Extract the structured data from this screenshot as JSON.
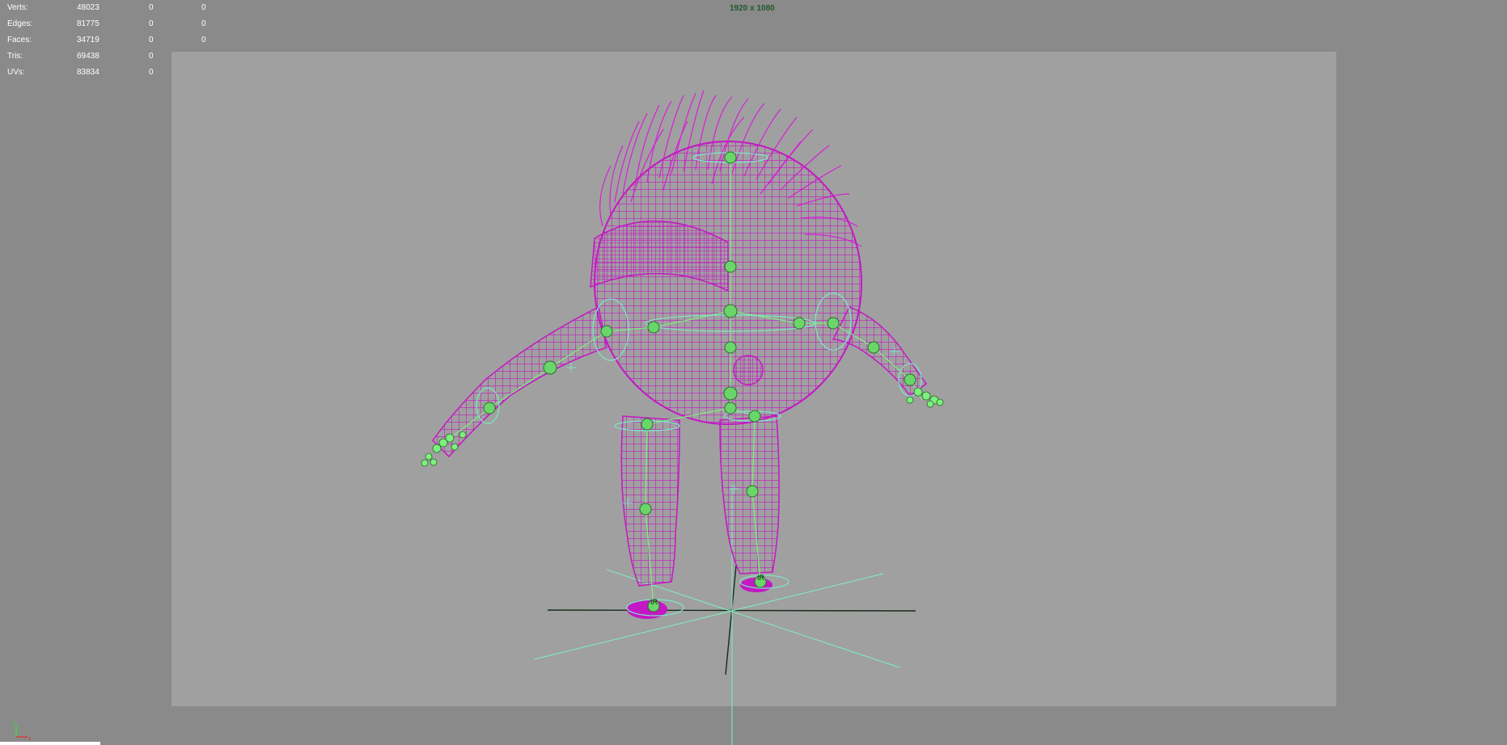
{
  "hud": {
    "rows": [
      {
        "label": "Verts:",
        "c1": "48023",
        "c2": "0",
        "c3": "0"
      },
      {
        "label": "Edges:",
        "c1": "81775",
        "c2": "0",
        "c3": "0"
      },
      {
        "label": "Faces:",
        "c1": "34719",
        "c2": "0",
        "c3": "0"
      },
      {
        "label": "Tris:",
        "c1": "69438",
        "c2": "0",
        "c3": "0"
      },
      {
        "label": "UVs:",
        "c1": "83834",
        "c2": "0",
        "c3": "0"
      }
    ]
  },
  "resolution_gate": {
    "label": "1920 x 1080"
  },
  "ik_handles": {
    "left_foot": "IR",
    "right_foot": "IR"
  },
  "axis": {
    "x": "x",
    "y": "y"
  },
  "colors": {
    "viewport_bg": "#8a8a8a",
    "gate_bg": "#a0a0a0",
    "mesh_wire": "#c418c4",
    "joint": "#7df07d",
    "control": "#7ee8c8",
    "grid": "#1a2a1a"
  }
}
